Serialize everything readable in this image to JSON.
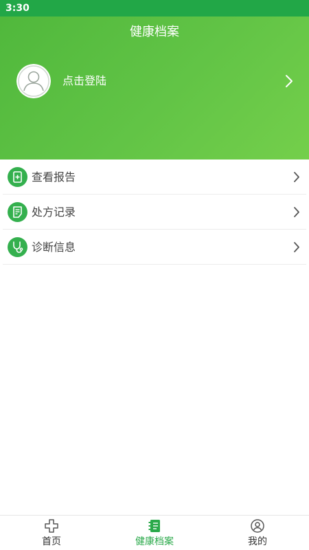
{
  "status_bar": {
    "time": "3:30"
  },
  "header": {
    "title": "健康档案",
    "login_label": "点击登陆"
  },
  "menu": {
    "items": [
      {
        "label": "查看报告",
        "icon": "report-icon"
      },
      {
        "label": "处方记录",
        "icon": "prescription-icon"
      },
      {
        "label": "诊断信息",
        "icon": "stethoscope-icon"
      }
    ]
  },
  "tab_bar": {
    "tabs": [
      {
        "label": "首页",
        "icon": "home-cross-icon",
        "active": false
      },
      {
        "label": "健康档案",
        "icon": "health-record-icon",
        "active": true
      },
      {
        "label": "我的",
        "icon": "user-icon",
        "active": false
      }
    ]
  },
  "colors": {
    "status_bar": "#22a747",
    "header_start": "#50b83c",
    "header_end": "#74cf4b",
    "icon_green": "#34b04e",
    "active_tab": "#2aa94a"
  }
}
